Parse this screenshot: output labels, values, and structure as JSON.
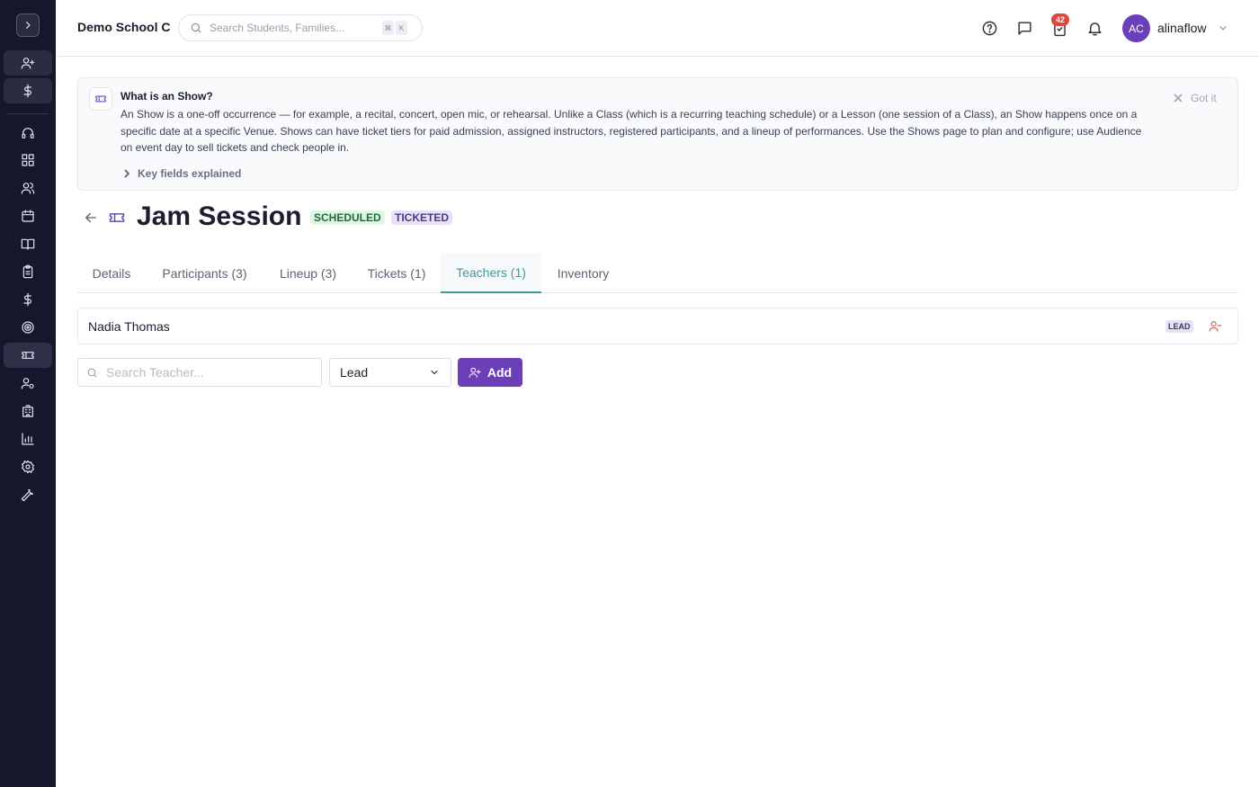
{
  "sidebar": {
    "toggle_icon": "chevron-right-icon",
    "items": [
      {
        "icon": "user-plus-icon"
      },
      {
        "icon": "dollar-icon"
      },
      {
        "icon": "headset-icon"
      },
      {
        "icon": "dashboard-icon"
      },
      {
        "icon": "users-icon"
      },
      {
        "icon": "calendar-icon"
      },
      {
        "icon": "book-icon"
      },
      {
        "icon": "clipboard-icon"
      },
      {
        "icon": "dollar-icon"
      },
      {
        "icon": "target-icon"
      },
      {
        "icon": "ticket-icon"
      },
      {
        "icon": "user-gear-icon"
      },
      {
        "icon": "building-icon"
      },
      {
        "icon": "bar-chart-icon"
      },
      {
        "icon": "gear-icon"
      },
      {
        "icon": "wrench-icon"
      }
    ]
  },
  "header": {
    "school_name": "Demo School C",
    "search_placeholder": "Search Students, Families...",
    "shortcut_keys": [
      "⌘",
      "K"
    ],
    "tasks_badge": "42",
    "user": {
      "initials": "AC",
      "name": "alinaflow"
    }
  },
  "banner": {
    "title": "What is an Show?",
    "text": "An Show is a one-off occurrence — for example, a recital, concert, open mic, or rehearsal. Unlike a Class (which is a recurring teaching schedule) or a Lesson (one session of a Class), an Show happens once on a specific date at a specific Venue. Shows can have ticket tiers for paid admission, assigned instructors, registered participants, and a lineup of performances. Use the Shows page to plan and configure; use Audience on event day to sell tickets and check people in.",
    "dismiss_label": "Got it",
    "key_fields_label": "Key fields explained"
  },
  "event": {
    "title": "Jam Session",
    "status": "SCHEDULED",
    "type": "TICKETED"
  },
  "tabs": [
    {
      "label": "Details"
    },
    {
      "label": "Participants (3)"
    },
    {
      "label": "Lineup (3)"
    },
    {
      "label": "Tickets (1)"
    },
    {
      "label": "Teachers (1)"
    },
    {
      "label": "Inventory"
    }
  ],
  "active_tab": "Teachers (1)",
  "teachers": [
    {
      "name": "Nadia Thomas",
      "role": "LEAD"
    }
  ],
  "add_teacher": {
    "search_placeholder": "Search Teacher...",
    "role_selected": "Lead",
    "add_label": "Add"
  },
  "colors": {
    "sidebar_bg": "#17172b",
    "accent_purple": "#6b3fb8",
    "tab_active": "#3f9c9a",
    "badge_red": "#e0443e"
  }
}
